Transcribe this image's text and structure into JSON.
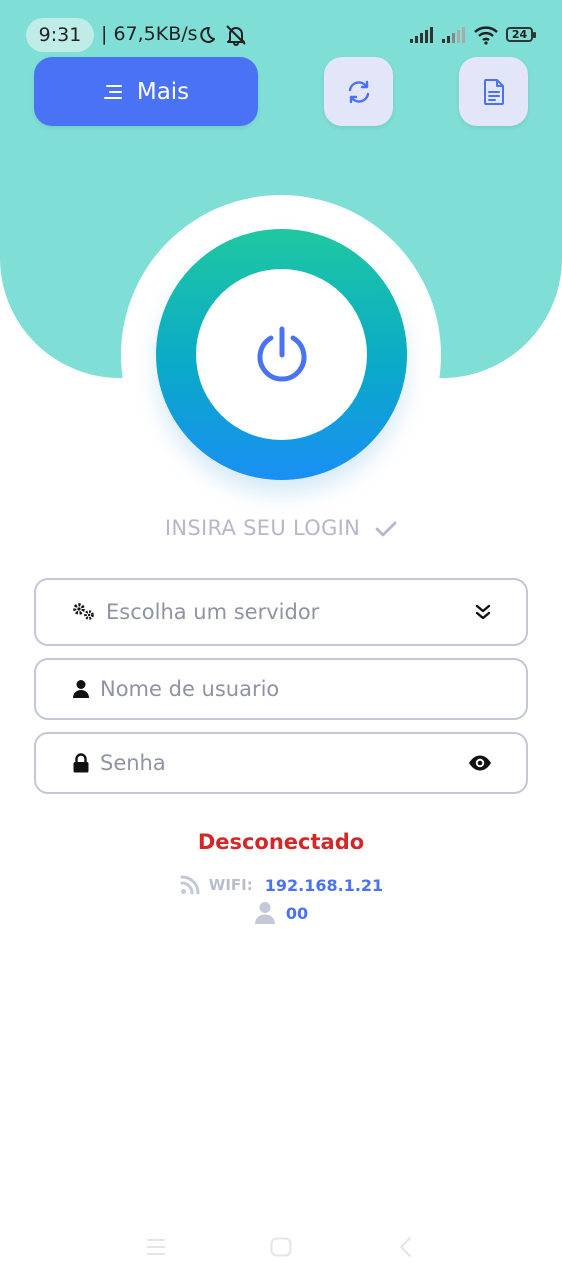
{
  "status_bar": {
    "time": "9:31",
    "net_speed": "| 67,5KB/s",
    "battery": "24"
  },
  "toolbar": {
    "menu_label": "Mais",
    "menu_icon": "menu-lines-icon",
    "refresh_icon": "refresh-icon",
    "document_icon": "document-icon"
  },
  "power": {
    "icon": "power-icon"
  },
  "login": {
    "hint": "INSIRA SEU LOGIN",
    "server_placeholder": "Escolha um servidor",
    "username_placeholder": "Nome de usuario",
    "password_placeholder": "Senha"
  },
  "connection": {
    "status": "Desconectado",
    "wifi_label": "WIFI:",
    "ip": "192.168.1.21",
    "user_count": "00"
  },
  "colors": {
    "hero": "#7fded6",
    "accent": "#4a72f5",
    "disconnected": "#d42828",
    "ring_top": "#1fc8a1",
    "ring_bottom": "#1a8ff4"
  }
}
